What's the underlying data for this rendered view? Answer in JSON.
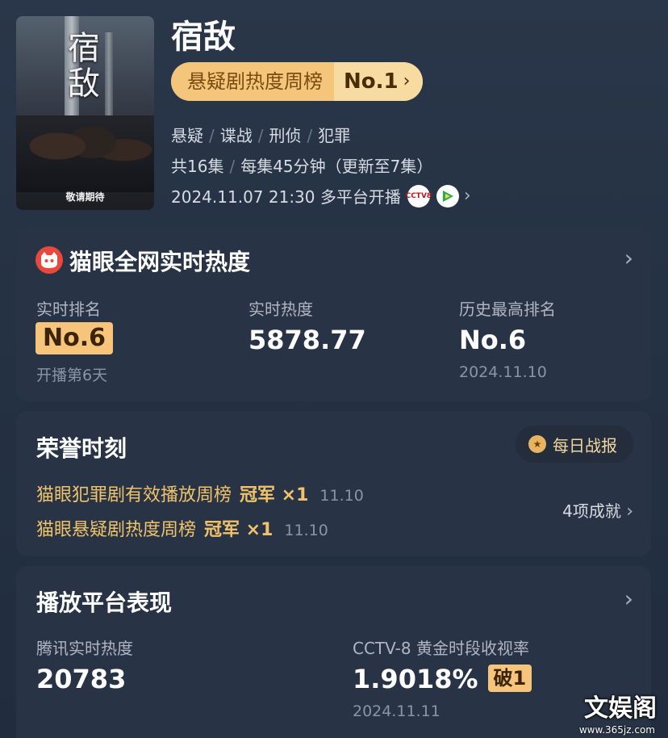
{
  "show": {
    "title": "宿敌",
    "poster_title": "宿敌",
    "poster_caption": "敬请期待",
    "rank_label": "悬疑剧热度周榜",
    "rank_value": "No.1",
    "genres": [
      "悬疑",
      "谍战",
      "刑侦",
      "犯罪"
    ],
    "episodes": "共16集",
    "duration": "每集45分钟（更新至7集）",
    "airtime": "2024.11.07 21:30 多平台开播",
    "platforms": [
      "cctv8-icon",
      "tencent-video-icon"
    ]
  },
  "maoyan": {
    "title": "猫眼全网实时热度",
    "realtime_rank_label": "实时排名",
    "realtime_rank_value": "No.6",
    "realtime_rank_sub": "开播第6天",
    "realtime_heat_label": "实时热度",
    "realtime_heat_value": "5878.77",
    "history_rank_label": "历史最高排名",
    "history_rank_value": "No.6",
    "history_rank_date": "2024.11.10"
  },
  "honors": {
    "title": "荣誉时刻",
    "daily_report": "每日战报",
    "items": [
      {
        "name": "猫眼犯罪剧有效播放周榜",
        "award": "冠军 ×1",
        "date": "11.10"
      },
      {
        "name": "猫眼悬疑剧热度周榜",
        "award": "冠军 ×1",
        "date": "11.10"
      }
    ],
    "achievements": "4项成就"
  },
  "platform_perf": {
    "title": "播放平台表现",
    "tencent_label": "腾讯实时热度",
    "tencent_value": "20783",
    "cctv_label": "CCTV-8 黄金时段收视率",
    "cctv_value": "1.9018%",
    "cctv_badge": "破1",
    "cctv_date": "2024.11.11"
  },
  "watermark": {
    "text": "文娱阁",
    "url": "www.365jz.com"
  },
  "colors": {
    "accent_gold": "#f6c47a",
    "honor_text": "#f0c36a",
    "maoyan_red": "#e8493c"
  }
}
